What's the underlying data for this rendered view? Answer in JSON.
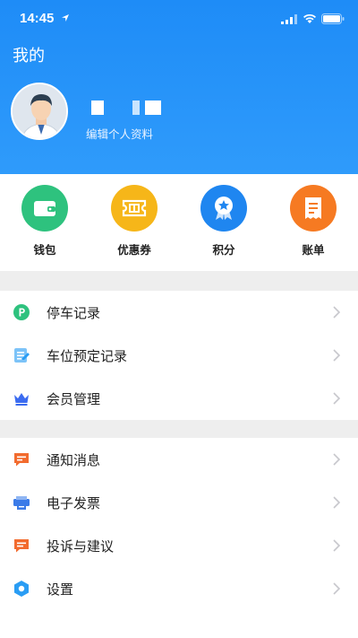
{
  "status_bar": {
    "time": "14:45"
  },
  "header": {
    "title": "我的",
    "edit_profile": "编辑个人资料"
  },
  "quick_actions": [
    {
      "label": "钱包",
      "icon": "wallet-icon",
      "color": "#2ec27e"
    },
    {
      "label": "优惠券",
      "icon": "coupon-icon",
      "color": "#f6b619"
    },
    {
      "label": "积分",
      "icon": "points-icon",
      "color": "#1f86f0"
    },
    {
      "label": "账单",
      "icon": "bill-icon",
      "color": "#f67a22"
    }
  ],
  "menu_group_1": [
    {
      "label": "停车记录",
      "icon": "parking-icon",
      "color": "#2ec27e"
    },
    {
      "label": "车位预定记录",
      "icon": "reservation-icon",
      "color": "#2a9df4"
    },
    {
      "label": "会员管理",
      "icon": "crown-icon",
      "color": "#3b6bf0"
    }
  ],
  "menu_group_2": [
    {
      "label": "通知消息",
      "icon": "message-icon",
      "color": "#f26b2e"
    },
    {
      "label": "电子发票",
      "icon": "invoice-icon",
      "color": "#3b7be8"
    },
    {
      "label": "投诉与建议",
      "icon": "feedback-icon",
      "color": "#f26b2e"
    },
    {
      "label": "设置",
      "icon": "settings-icon",
      "color": "#2a9df4"
    }
  ],
  "colors": {
    "header_start": "#1e8cf7",
    "header_end": "#2f9bfb",
    "section_gap": "#eeeeee",
    "chevron": "#c7c7cc"
  }
}
